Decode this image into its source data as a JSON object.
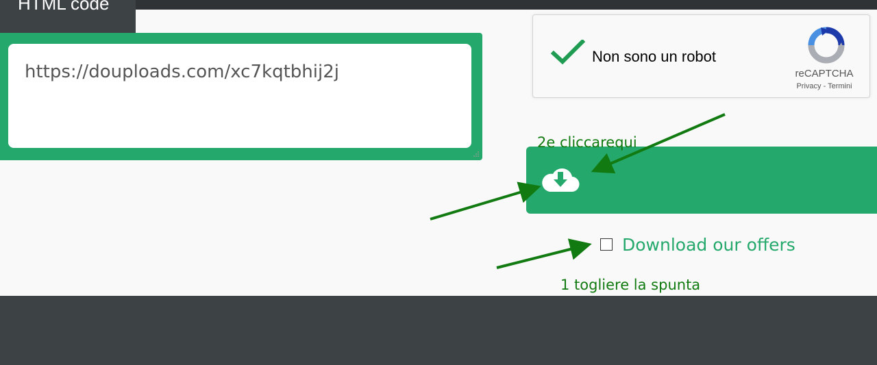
{
  "tab": {
    "label": "HTML code"
  },
  "link": {
    "value": "https://douploads.com/xc7kqtbhij2j"
  },
  "recaptcha": {
    "label": "Non sono un robot",
    "brand": "reCAPTCHA",
    "privacy": "Privacy",
    "separator": " - ",
    "terms": "Termini",
    "checked": true
  },
  "download": {
    "icon": "cloud-download-icon"
  },
  "offers": {
    "label": "Download our offers",
    "checked": false
  },
  "annotations": {
    "step2": "2e cliccarequi",
    "step1": "1 togliere la spunta"
  },
  "colors": {
    "accent_green": "#25a86b",
    "annotation_green": "#117a11",
    "footer": "#3d4245"
  }
}
